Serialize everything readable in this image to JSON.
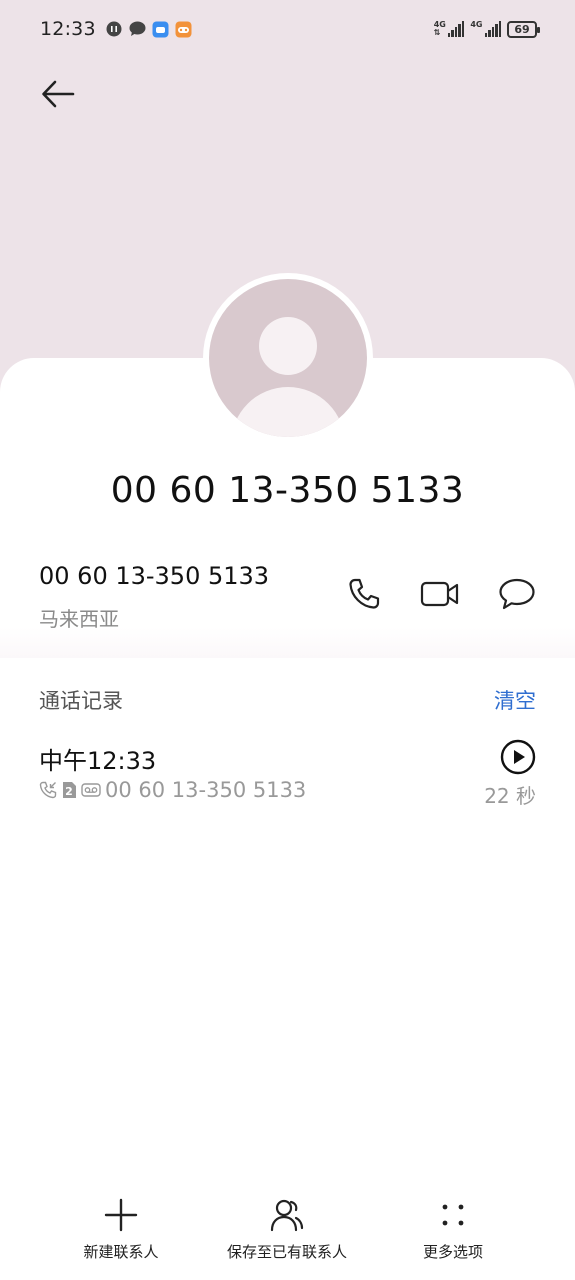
{
  "status_bar": {
    "time": "12:33",
    "icons": [
      "media-icon",
      "message-bubble-icon",
      "app-blue-icon",
      "game-orange-icon"
    ],
    "sim1_network": "4G",
    "sim2_network": "4G",
    "battery": "69"
  },
  "header": {
    "back_icon": "arrow-left-icon",
    "background_color": "#ede3e8"
  },
  "contact": {
    "display_number": "00 60 13-350 5133",
    "number": "00 60 13-350 5133",
    "region": "马来西亚",
    "actions": [
      "phone-icon",
      "video-call-icon",
      "message-icon"
    ]
  },
  "call_log": {
    "section_title": "通话记录",
    "clear_label": "清空",
    "clear_color": "#2f6ed0",
    "entries": [
      {
        "time": "中午12:33",
        "number": "00 60 13-350 5133",
        "sim": "2",
        "duration": "22 秒"
      }
    ]
  },
  "bottom_bar": {
    "items": [
      {
        "label": "新建联系人",
        "icon": "plus-icon"
      },
      {
        "label": "保存至已有联系人",
        "icon": "person-add-icon"
      },
      {
        "label": "更多选项",
        "icon": "more-dots-icon"
      }
    ]
  }
}
